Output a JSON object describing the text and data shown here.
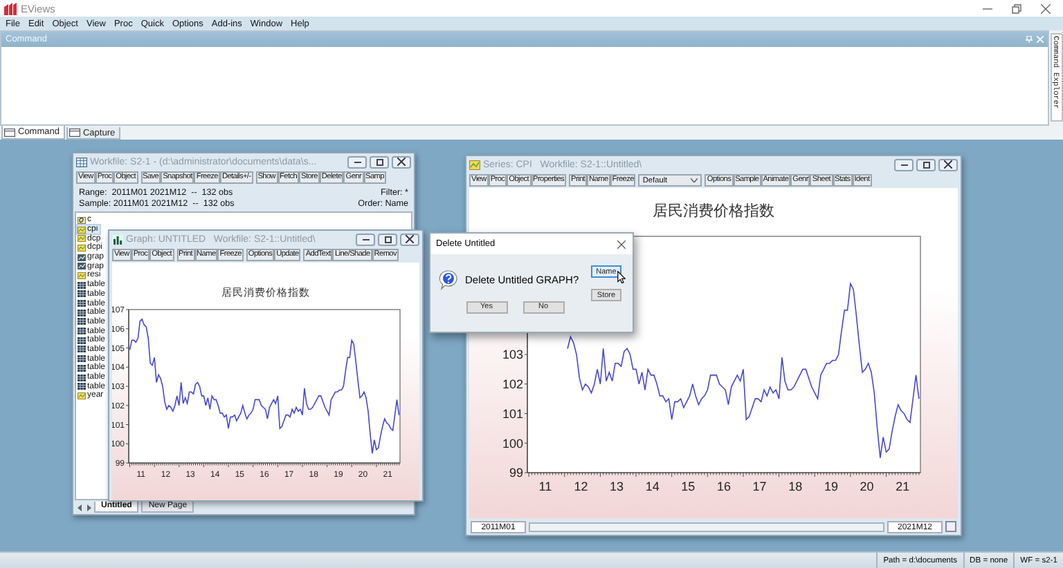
{
  "app": {
    "title": "EViews",
    "menu": [
      "File",
      "Edit",
      "Object",
      "View",
      "Proc",
      "Quick",
      "Options",
      "Add-ins",
      "Window",
      "Help"
    ]
  },
  "command_panel": {
    "title": "Command",
    "side_tab": "Command Explorer",
    "tabs": [
      {
        "label": "Command",
        "selected": true
      },
      {
        "label": "Capture",
        "selected": false
      }
    ]
  },
  "workfile_window": {
    "title": "Workfile: S2-1 - (d:\\administrator\\documents\\data\\s...",
    "toolbar": [
      {
        "kind": "buttons",
        "labels": [
          "View",
          "Proc",
          "Object"
        ]
      },
      {
        "kind": "buttons",
        "labels": [
          "Save",
          "Snapshot",
          "Freeze",
          "Details+/-"
        ]
      },
      {
        "kind": "buttons",
        "labels": [
          "Show",
          "Fetch",
          "Store",
          "Delete",
          "Genr",
          "Samp"
        ]
      }
    ],
    "range": "Range:  2011M01 2021M12  --  132 obs",
    "filter": "Filter: *",
    "sample": "Sample: 2011M01 2021M12  --  132 obs",
    "order": "Order: Name",
    "objects": [
      {
        "name": "c",
        "kind": "coef",
        "selected": false
      },
      {
        "name": "cpi",
        "kind": "series",
        "selected": true
      },
      {
        "name": "dcp",
        "kind": "series",
        "selected": false
      },
      {
        "name": "dcpi",
        "kind": "series",
        "selected": false
      },
      {
        "name": "grap",
        "kind": "graph",
        "selected": false
      },
      {
        "name": "grap",
        "kind": "graph",
        "selected": false
      },
      {
        "name": "resi",
        "kind": "series",
        "selected": false
      },
      {
        "name": "table",
        "kind": "table",
        "selected": false
      },
      {
        "name": "table",
        "kind": "table",
        "selected": false
      },
      {
        "name": "table",
        "kind": "table",
        "selected": false
      },
      {
        "name": "table",
        "kind": "table",
        "selected": false
      },
      {
        "name": "table",
        "kind": "table",
        "selected": false
      },
      {
        "name": "table",
        "kind": "table",
        "selected": false
      },
      {
        "name": "table",
        "kind": "table",
        "selected": false
      },
      {
        "name": "table",
        "kind": "table",
        "selected": false
      },
      {
        "name": "table",
        "kind": "table",
        "selected": false
      },
      {
        "name": "table",
        "kind": "table",
        "selected": false
      },
      {
        "name": "table",
        "kind": "table",
        "selected": false
      },
      {
        "name": "table",
        "kind": "table",
        "selected": false
      },
      {
        "name": "year",
        "kind": "series",
        "selected": false
      }
    ],
    "page_tabs": [
      {
        "label": "Untitled",
        "selected": true
      },
      {
        "label": "New Page",
        "selected": false
      }
    ]
  },
  "graph_window": {
    "title": "Graph: UNTITLED   Workfile: S2-1::Untitled\\",
    "toolbar": [
      {
        "kind": "buttons",
        "labels": [
          "View",
          "Proc",
          "Object"
        ]
      },
      {
        "kind": "buttons",
        "labels": [
          "Print",
          "Name",
          "Freeze"
        ]
      },
      {
        "kind": "buttons",
        "labels": [
          "Options",
          "Update"
        ]
      },
      {
        "kind": "buttons",
        "labels": [
          "AddText",
          "Line/Shade",
          "Remov"
        ]
      }
    ],
    "chart_data": {
      "type": "line",
      "title": "居民消费价格指数",
      "x": [
        10.542,
        10.625,
        10.708,
        10.792,
        10.875,
        10.958,
        11.042,
        11.125,
        11.208,
        11.292,
        11.375,
        11.458,
        11.542,
        11.625,
        11.708,
        11.792,
        11.875,
        11.958,
        12.042,
        12.125,
        12.208,
        12.292,
        12.375,
        12.458,
        12.542,
        12.625,
        12.708,
        12.792,
        12.875,
        12.958,
        13.042,
        13.125,
        13.208,
        13.292,
        13.375,
        13.458,
        13.542,
        13.625,
        13.708,
        13.792,
        13.875,
        13.958,
        14.042,
        14.125,
        14.208,
        14.292,
        14.375,
        14.458,
        14.542,
        14.625,
        14.708,
        14.792,
        14.875,
        14.958,
        15.042,
        15.125,
        15.208,
        15.292,
        15.375,
        15.458,
        15.542,
        15.625,
        15.708,
        15.792,
        15.875,
        15.958,
        16.042,
        16.125,
        16.208,
        16.292,
        16.375,
        16.458,
        16.542,
        16.625,
        16.708,
        16.792,
        16.875,
        16.958,
        17.042,
        17.125,
        17.208,
        17.292,
        17.375,
        17.458,
        17.542,
        17.625,
        17.708,
        17.792,
        17.875,
        17.958,
        18.042,
        18.125,
        18.208,
        18.292,
        18.375,
        18.458,
        18.542,
        18.625,
        18.708,
        18.792,
        18.875,
        18.958,
        19.042,
        19.125,
        19.208,
        19.292,
        19.375,
        19.458,
        19.542,
        19.625,
        19.708,
        19.792,
        19.875,
        19.958,
        20.042,
        20.125,
        20.208,
        20.292,
        20.375,
        20.458,
        20.542,
        20.625,
        20.708,
        20.792,
        20.875,
        20.958,
        21.042,
        21.125,
        21.208,
        21.292,
        21.375,
        21.458
      ],
      "xlim": [
        10.5,
        21.5
      ],
      "ylim": [
        99,
        107
      ],
      "yticks": [
        99,
        100,
        101,
        102,
        103,
        104,
        105,
        106,
        107
      ],
      "xticks": [
        11,
        12,
        13,
        14,
        15,
        16,
        17,
        18,
        19,
        20,
        21
      ],
      "series": [
        {
          "color": "#4848d0",
          "values": [
            104.9,
            105.4,
            105.4,
            105.3,
            105.5,
            106.4,
            106.5,
            106.2,
            106.1,
            105.5,
            104.2,
            104.1,
            104.5,
            103.2,
            103.6,
            103.4,
            103.0,
            102.2,
            101.8,
            102.0,
            101.9,
            101.7,
            102.0,
            102.5,
            102.0,
            103.2,
            102.1,
            102.4,
            102.1,
            102.7,
            102.7,
            102.6,
            103.1,
            103.2,
            103.0,
            102.5,
            102.5,
            102.0,
            102.4,
            101.8,
            102.5,
            102.3,
            102.3,
            102.0,
            101.6,
            101.6,
            101.4,
            101.5,
            100.8,
            101.4,
            101.4,
            101.5,
            101.2,
            101.4,
            101.6,
            102.0,
            101.6,
            101.3,
            101.5,
            101.6,
            101.8,
            102.3,
            102.3,
            102.3,
            102.0,
            101.9,
            101.8,
            101.3,
            101.9,
            102.1,
            102.3,
            102.1,
            102.5,
            100.8,
            100.9,
            101.2,
            101.5,
            101.5,
            101.4,
            101.8,
            101.6,
            101.9,
            101.7,
            101.8,
            101.5,
            102.9,
            102.1,
            101.8,
            101.8,
            101.9,
            102.1,
            102.3,
            102.5,
            102.5,
            102.2,
            101.9,
            101.7,
            101.5,
            102.3,
            102.5,
            102.7,
            102.7,
            102.8,
            102.8,
            103.0,
            103.8,
            104.5,
            104.5,
            105.4,
            105.2,
            104.3,
            103.3,
            102.4,
            102.5,
            102.7,
            102.4,
            101.7,
            100.5,
            99.5,
            100.2,
            99.7,
            99.8,
            100.4,
            100.9,
            101.3,
            101.1,
            101.0,
            100.8,
            100.7,
            101.5,
            102.3,
            101.5
          ]
        }
      ]
    }
  },
  "series_window": {
    "title": "Series: CPI   Workfile: S2-1::Untitled\\",
    "toolbar": [
      {
        "kind": "buttons",
        "labels": [
          "View",
          "Proc",
          "Object",
          "Properties"
        ]
      },
      {
        "kind": "buttons",
        "labels": [
          "Print",
          "Name",
          "Freeze"
        ]
      },
      {
        "kind": "dropdown",
        "value": "Default"
      },
      {
        "kind": "buttons",
        "labels": [
          "Options",
          "Sample",
          "Animate",
          "Genr",
          "Sheet",
          "Stats",
          "Ident"
        ]
      }
    ],
    "chart_data": {
      "type": "line",
      "title": "居民消费价格指数",
      "x": [
        11.625,
        11.708,
        11.792,
        11.875,
        11.958,
        12.042,
        12.125,
        12.208,
        12.292,
        12.375,
        12.458,
        12.542,
        12.625,
        12.708,
        12.792,
        12.875,
        12.958,
        13.042,
        13.125,
        13.208,
        13.292,
        13.375,
        13.458,
        13.542,
        13.625,
        13.708,
        13.792,
        13.875,
        13.958,
        14.042,
        14.125,
        14.208,
        14.292,
        14.375,
        14.458,
        14.542,
        14.625,
        14.708,
        14.792,
        14.875,
        14.958,
        15.042,
        15.125,
        15.208,
        15.292,
        15.375,
        15.458,
        15.542,
        15.625,
        15.708,
        15.792,
        15.875,
        15.958,
        16.042,
        16.125,
        16.208,
        16.292,
        16.375,
        16.458,
        16.542,
        16.625,
        16.708,
        16.792,
        16.875,
        16.958,
        17.042,
        17.125,
        17.208,
        17.292,
        17.375,
        17.458,
        17.542,
        17.625,
        17.708,
        17.792,
        17.875,
        17.958,
        18.042,
        18.125,
        18.208,
        18.292,
        18.375,
        18.458,
        18.542,
        18.625,
        18.708,
        18.792,
        18.875,
        18.958,
        19.042,
        19.125,
        19.208,
        19.292,
        19.375,
        19.458,
        19.542,
        19.625,
        19.708,
        19.792,
        19.875,
        19.958,
        20.042,
        20.125,
        20.208,
        20.292,
        20.375,
        20.458,
        20.542,
        20.625,
        20.708,
        20.792,
        20.875,
        20.958,
        21.042,
        21.125,
        21.208,
        21.292,
        21.375,
        21.458
      ],
      "xlim": [
        10.5,
        21.5
      ],
      "ylim": [
        99,
        107
      ],
      "yticks": [
        99,
        100,
        101,
        102,
        103
      ],
      "xticks": [
        11,
        12,
        13,
        14,
        15,
        16,
        17,
        18,
        19,
        20,
        21
      ],
      "series": [
        {
          "color": "#4848d0",
          "values": [
            103.2,
            103.6,
            103.4,
            103.0,
            102.2,
            101.8,
            102.0,
            101.9,
            101.7,
            102.0,
            102.5,
            102.0,
            103.2,
            102.1,
            102.4,
            102.1,
            102.7,
            102.7,
            102.6,
            103.1,
            103.2,
            103.0,
            102.5,
            102.5,
            102.0,
            102.4,
            101.8,
            102.5,
            102.3,
            102.3,
            102.0,
            101.6,
            101.6,
            101.4,
            101.5,
            100.8,
            101.4,
            101.4,
            101.5,
            101.2,
            101.4,
            101.6,
            102.0,
            101.6,
            101.3,
            101.5,
            101.6,
            101.8,
            102.3,
            102.3,
            102.3,
            102.0,
            101.9,
            101.8,
            101.3,
            101.9,
            102.1,
            102.3,
            102.1,
            102.5,
            100.8,
            100.9,
            101.2,
            101.5,
            101.5,
            101.4,
            101.8,
            101.6,
            101.9,
            101.7,
            101.8,
            101.5,
            102.9,
            102.1,
            101.8,
            101.8,
            101.9,
            102.1,
            102.3,
            102.5,
            102.5,
            102.2,
            101.9,
            101.7,
            101.5,
            102.3,
            102.5,
            102.7,
            102.7,
            102.8,
            102.8,
            103.0,
            103.8,
            104.5,
            104.5,
            105.4,
            105.2,
            104.3,
            103.3,
            102.4,
            102.5,
            102.7,
            102.4,
            101.7,
            100.5,
            99.5,
            100.2,
            99.7,
            99.8,
            100.4,
            100.9,
            101.3,
            101.1,
            101.0,
            100.8,
            100.7,
            101.5,
            102.3,
            101.5
          ]
        }
      ]
    },
    "sample_start": "2011M01",
    "sample_end": "2021M12"
  },
  "dialog": {
    "title": "Delete Untitled",
    "message": "Delete Untitled GRAPH?",
    "side_buttons": [
      {
        "label": "Name",
        "focused": true
      },
      {
        "label": "Store",
        "focused": false
      }
    ],
    "buttons": [
      {
        "label": "Yes",
        "focused": false
      },
      {
        "label": "No",
        "focused": false
      }
    ]
  },
  "status_bar": [
    "Path = d:\\documents",
    "DB = none",
    "WF = s2-1"
  ]
}
